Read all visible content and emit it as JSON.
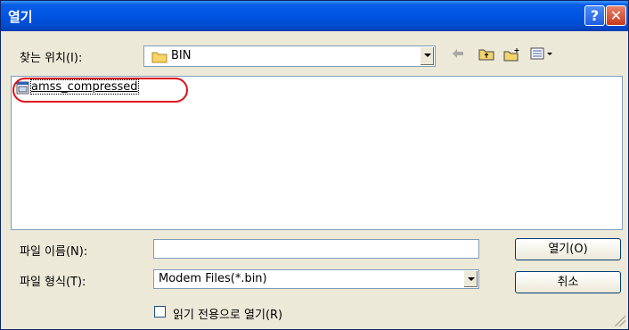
{
  "window": {
    "title": "열기"
  },
  "titlebar_buttons": {
    "help": "?",
    "close": "✕"
  },
  "look_in": {
    "label": "찾는 위치(I):",
    "value": "BIN"
  },
  "file_list": {
    "items": [
      {
        "name": "amss_compressed",
        "icon": "document-icon",
        "highlighted": true
      }
    ]
  },
  "file_name": {
    "label": "파일 이름(N):",
    "value": ""
  },
  "file_type": {
    "label": "파일 형식(T):",
    "value": "Modem Files(*.bin)"
  },
  "buttons": {
    "open": "열기(O)",
    "cancel": "취소"
  },
  "readonly_checkbox": {
    "label": "읽기 전용으로 열기(R)",
    "checked": false
  },
  "colors": {
    "titlebar": "#0054e3",
    "dialog_bg": "#ece9d8",
    "highlight_ring": "#e0101a"
  }
}
